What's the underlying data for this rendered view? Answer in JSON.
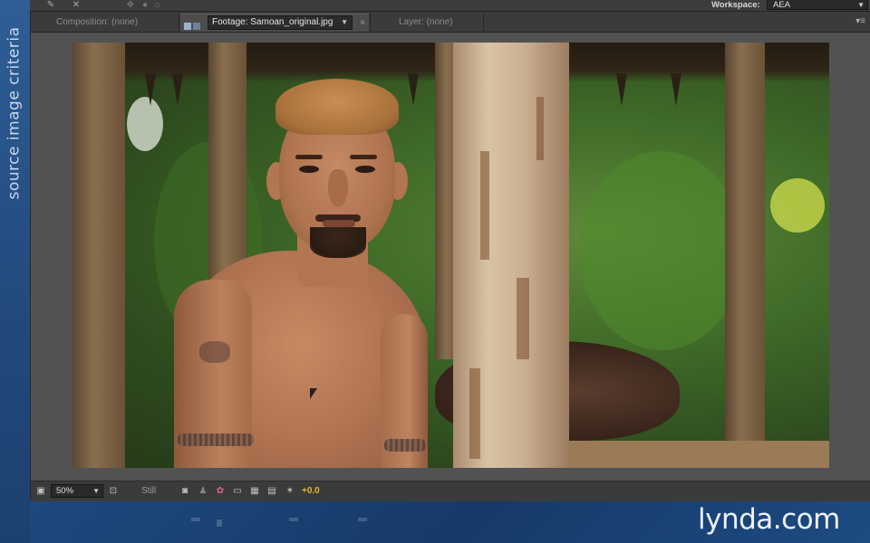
{
  "sidebar": {
    "vertical_label": "source image criteria"
  },
  "topbar": {
    "workspace_label": "Workspace:",
    "workspace_value": "AEA"
  },
  "panel": {
    "tabs": {
      "composition": "Composition: (none)",
      "footage": "Footage: Samoan_original.jpg",
      "layer": "Layer: (none)"
    }
  },
  "viewer_toolbar": {
    "zoom": "50%",
    "still": "Still",
    "exposure": "+0.0"
  },
  "logo": {
    "name": "lynda.com"
  },
  "colors": {
    "accent_exposure": "#e6b62e",
    "background_blue": "#1e4a80",
    "panel_gray": "#525252"
  }
}
